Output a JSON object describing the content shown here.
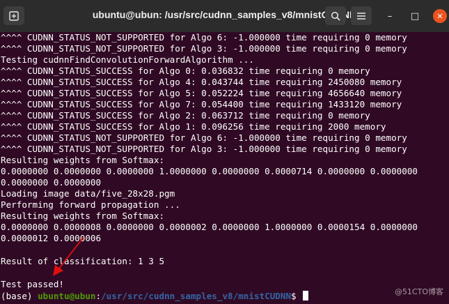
{
  "window": {
    "title": "ubuntu@ubun: /usr/src/cudnn_samples_v8/mnistCUDNN",
    "new_tab_icon": "new-tab-icon",
    "search_icon": "search-icon",
    "menu_icon": "hamburger-menu-icon",
    "minimize_glyph": "–",
    "maximize_glyph": "□",
    "close_glyph": "✕"
  },
  "terminal": {
    "lines": [
      "^^^^ CUDNN_STATUS_NOT_SUPPORTED for Algo 6: -1.000000 time requiring 0 memory",
      "^^^^ CUDNN_STATUS_NOT_SUPPORTED for Algo 3: -1.000000 time requiring 0 memory",
      "Testing cudnnFindConvolutionForwardAlgorithm ...",
      "^^^^ CUDNN_STATUS_SUCCESS for Algo 0: 0.036832 time requiring 0 memory",
      "^^^^ CUDNN_STATUS_SUCCESS for Algo 4: 0.043744 time requiring 2450080 memory",
      "^^^^ CUDNN_STATUS_SUCCESS for Algo 5: 0.052224 time requiring 4656640 memory",
      "^^^^ CUDNN_STATUS_SUCCESS for Algo 7: 0.054400 time requiring 1433120 memory",
      "^^^^ CUDNN_STATUS_SUCCESS for Algo 2: 0.063712 time requiring 0 memory",
      "^^^^ CUDNN_STATUS_SUCCESS for Algo 1: 0.096256 time requiring 2000 memory",
      "^^^^ CUDNN_STATUS_NOT_SUPPORTED for Algo 6: -1.000000 time requiring 0 memory",
      "^^^^ CUDNN_STATUS_NOT_SUPPORTED for Algo 3: -1.000000 time requiring 0 memory",
      "Resulting weights from Softmax:",
      "0.0000000 0.0000000 0.0000000 1.0000000 0.0000000 0.0000714 0.0000000 0.0000000",
      "0.0000000 0.0000000",
      "Loading image data/five_28x28.pgm",
      "Performing forward propagation ...",
      "Resulting weights from Softmax:",
      "0.0000000 0.0000008 0.0000000 0.0000002 0.0000000 1.0000000 0.0000154 0.0000000",
      "0.0000012 0.0000006",
      "",
      "Result of classification: 1 3 5",
      "",
      "Test passed!"
    ],
    "prompt": {
      "env": "(base) ",
      "user_host": "ubuntu@ubun",
      "sep": ":",
      "path": "/usr/src/cudnn_samples_v8/mnistCUDNN",
      "symbol": "$ "
    }
  },
  "watermark": "@51CTO博客",
  "colors": {
    "background": "#300a24",
    "prompt_user": "#4e9a06",
    "prompt_path": "#3465a4",
    "annotation_arrow": "#e01010"
  }
}
